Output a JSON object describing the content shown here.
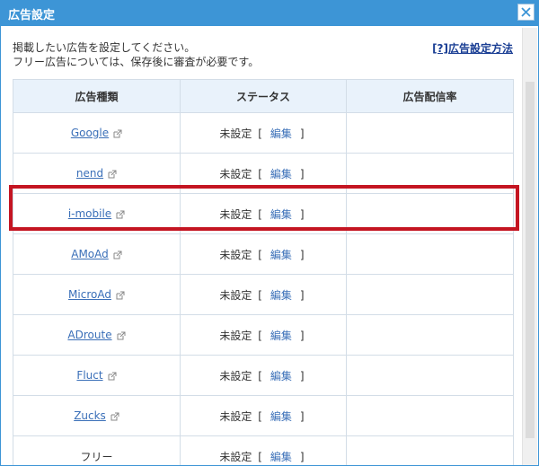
{
  "dialog": {
    "title": "広告設定",
    "intro_line1": "掲載したい広告を設定してください。",
    "intro_line2": "フリー広告については、保存後に審査が必要です。",
    "help_link": "[?]広告設定方法",
    "accent_color": "#3d95d6",
    "highlight_color": "#c41522"
  },
  "table": {
    "headers": [
      "広告種類",
      "ステータス",
      "広告配信率"
    ],
    "rows": [
      {
        "provider": "Google",
        "status": "未設定",
        "edit": "編集",
        "rate": ""
      },
      {
        "provider": "nend",
        "status": "未設定",
        "edit": "編集",
        "rate": ""
      },
      {
        "provider": "i-mobile",
        "status": "未設定",
        "edit": "編集",
        "rate": ""
      },
      {
        "provider": "AMoAd",
        "status": "未設定",
        "edit": "編集",
        "rate": ""
      },
      {
        "provider": "MicroAd",
        "status": "未設定",
        "edit": "編集",
        "rate": ""
      },
      {
        "provider": "ADroute",
        "status": "未設定",
        "edit": "編集",
        "rate": ""
      },
      {
        "provider": "Fluct",
        "status": "未設定",
        "edit": "編集",
        "rate": ""
      },
      {
        "provider": "Zucks",
        "status": "未設定",
        "edit": "編集",
        "rate": ""
      },
      {
        "provider": "フリー",
        "status": "未設定",
        "edit": "編集",
        "rate": ""
      }
    ]
  },
  "brackets": {
    "open": "[",
    "close": "]"
  },
  "icons": {
    "close": "close-icon",
    "external": "external-link-icon"
  }
}
